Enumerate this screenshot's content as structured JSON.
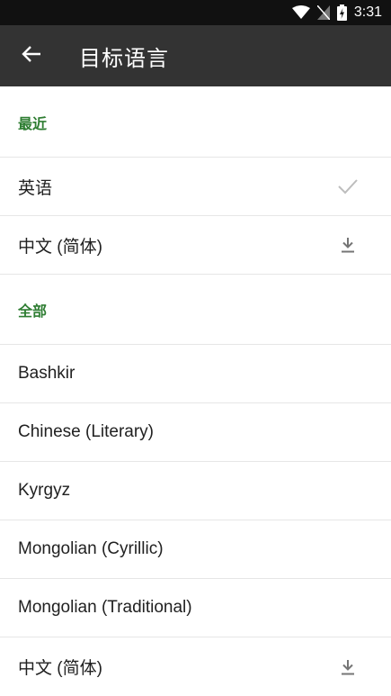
{
  "status_bar": {
    "time": "3:31",
    "icons": [
      "wifi-icon",
      "no-sim-icon",
      "battery-charging-icon"
    ]
  },
  "app_bar": {
    "title": "目标语言",
    "back_icon": "arrow-left-icon"
  },
  "sections": {
    "recent": {
      "header": "最近",
      "items": [
        {
          "label": "英语",
          "icon": "check-icon"
        },
        {
          "label": "中文 (简体)",
          "icon": "download-icon"
        }
      ]
    },
    "all": {
      "header": "全部",
      "items": [
        {
          "label": "Bashkir"
        },
        {
          "label": "Chinese (Literary)"
        },
        {
          "label": "Kyrgyz"
        },
        {
          "label": "Mongolian (Cyrillic)"
        },
        {
          "label": "Mongolian (Traditional)"
        },
        {
          "label": "中文 (简体)",
          "icon": "download-icon"
        }
      ]
    }
  },
  "colors": {
    "status_bar": "#111111",
    "app_bar": "#333333",
    "section_header": "#2e7d32",
    "divider": "#e6e6e6",
    "icon_gray": "#757575",
    "check_gray": "#bdbdbd"
  }
}
